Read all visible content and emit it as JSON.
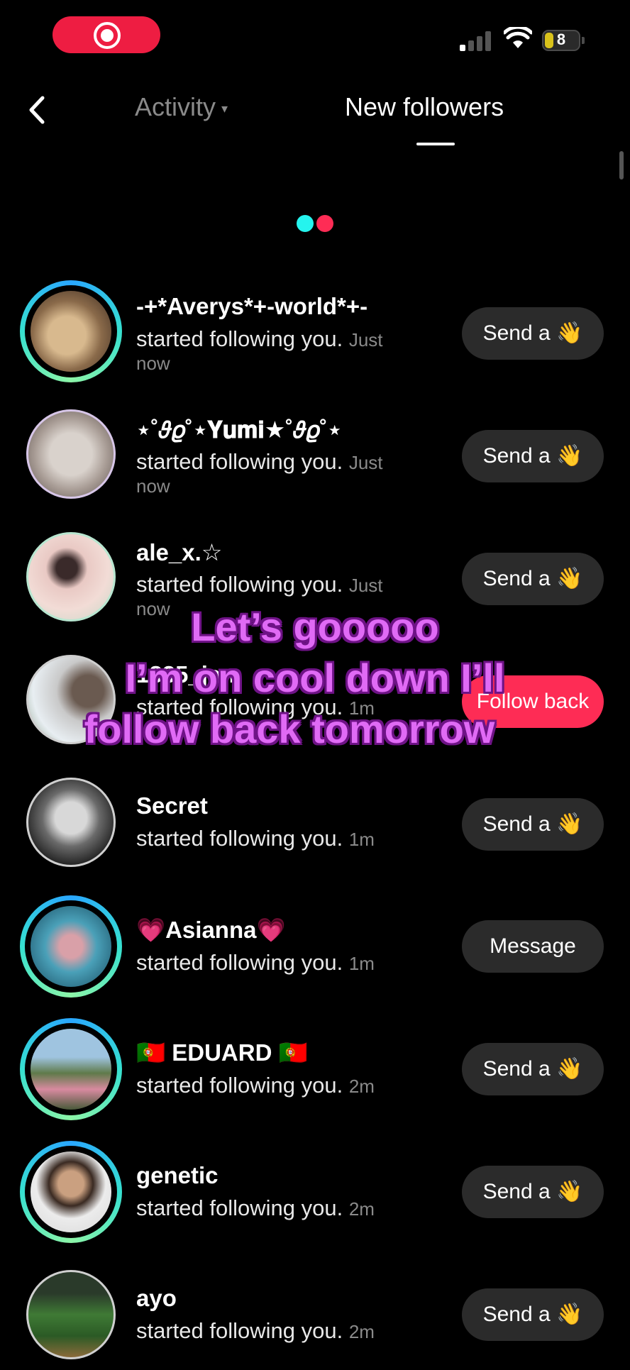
{
  "status_bar": {
    "battery": "8"
  },
  "header": {
    "tab_activity": "Activity",
    "tab_new_followers": "New followers"
  },
  "followers": [
    {
      "name": "-+*Averys*+-world*+-",
      "status": "started following you.",
      "time": "Just",
      "time2": "now",
      "button": "Send a",
      "button_icon": "👋"
    },
    {
      "name": "⋆˚𝜗𝜚˚⋆𝐘𝐮𝐦𝐢★˚𝜗𝜚˚⋆",
      "status": "started following you.",
      "time": "Just",
      "time2": "now",
      "button": "Send a",
      "button_icon": "👋"
    },
    {
      "name": "ale_x.☆",
      "status": "started following you.",
      "time": "Just",
      "time2": "now",
      "button": "Send a",
      "button_icon": "👋"
    },
    {
      "name": "1835_jan",
      "status": "started following you.",
      "time": "1m",
      "button": "Follow back"
    },
    {
      "name": "Secret",
      "status": "started following you.",
      "time": "1m",
      "button": "Send a",
      "button_icon": "👋"
    },
    {
      "name": "💗Asianna💗",
      "status": "started following you.",
      "time": "1m",
      "button": "Message"
    },
    {
      "name": "🇵🇹 EDUARD 🇵🇹",
      "status": "started following you.",
      "time": "2m",
      "button": "Send a",
      "button_icon": "👋"
    },
    {
      "name": "genetic",
      "status": "started following you.",
      "time": "2m",
      "button": "Send a",
      "button_icon": "👋"
    },
    {
      "name": "ayo",
      "status": "started following you.",
      "time": "2m",
      "button": "Send a",
      "button_icon": "👋"
    }
  ],
  "caption": {
    "line1": "Let’s gooooo",
    "line2": "I’m on cool down I’ll",
    "line3": "follow back tomorrow"
  },
  "colors": {
    "accent_red": "#fe2c55",
    "accent_cyan": "#25f4ee",
    "caption_pink": "#e06af5"
  }
}
